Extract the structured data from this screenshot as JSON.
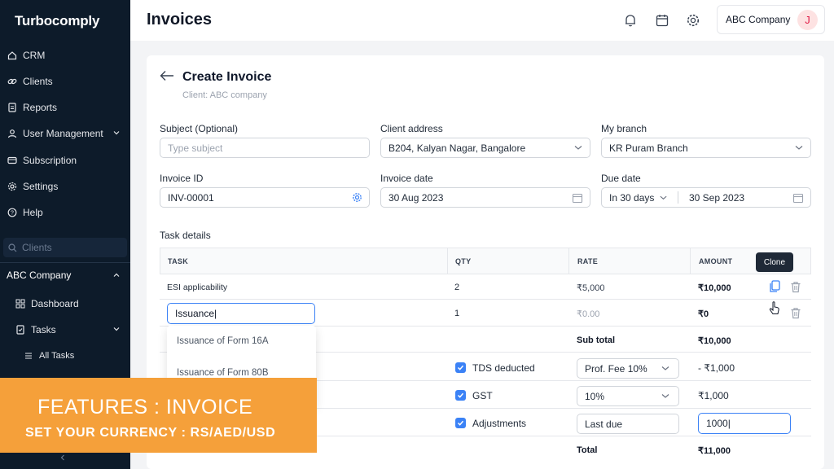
{
  "app": {
    "brand": "Turbocomply",
    "page_title": "Invoices"
  },
  "sidebar": {
    "items": [
      {
        "label": "CRM",
        "icon": "home-icon"
      },
      {
        "label": "Clients",
        "icon": "link-icon"
      },
      {
        "label": "Reports",
        "icon": "report-icon"
      },
      {
        "label": "User Management",
        "icon": "user-icon"
      },
      {
        "label": "Subscription",
        "icon": "subscription-icon"
      },
      {
        "label": "Settings",
        "icon": "gear-icon"
      },
      {
        "label": "Help",
        "icon": "help-icon"
      }
    ],
    "search_placeholder": "Clients",
    "company": "ABC Company",
    "sub_items": [
      {
        "label": "Dashboard",
        "icon": "dashboard-icon"
      },
      {
        "label": "Tasks",
        "icon": "tasks-icon"
      },
      {
        "label": "All Tasks",
        "icon": "list-icon"
      }
    ]
  },
  "header": {
    "company": "ABC Company",
    "avatar_initial": "J"
  },
  "form": {
    "title": "Create Invoice",
    "client_line": "Client: ABC company",
    "subject_label": "Subject (Optional)",
    "subject_placeholder": "Type subject",
    "client_address_label": "Client address",
    "client_address_value": "B204, Kalyan Nagar, Bangalore",
    "branch_label": "My branch",
    "branch_value": "KR Puram Branch",
    "invoice_id_label": "Invoice ID",
    "invoice_id_value": "INV-00001",
    "invoice_date_label": "Invoice date",
    "invoice_date_value": "30 Aug 2023",
    "due_date_label": "Due date",
    "due_in_value": "In 30 days",
    "due_date_value": "30 Sep 2023"
  },
  "tasks": {
    "section_label": "Task details",
    "columns": [
      "TASK",
      "QTY",
      "RATE",
      "AMOUNT"
    ],
    "rows": [
      {
        "task": "ESI applicability",
        "qty": "2",
        "rate": "₹5,000",
        "amount": "₹10,000"
      },
      {
        "task": "Issuance|",
        "qty": "1",
        "rate": "₹0.00",
        "amount": "₹0"
      }
    ],
    "suggestions": [
      "Issuance of Form 16A",
      "Issuance of Form 80B"
    ],
    "subtotal_label": "Sub total",
    "subtotal_value": "₹10,000",
    "adjust_rows": [
      {
        "label": "TDS deducted",
        "select": "Prof. Fee 10%",
        "amount": "- ₹1,000"
      },
      {
        "label": "GST",
        "select": "10%",
        "amount": "₹1,000"
      },
      {
        "label": "Adjustments",
        "select": "Last due",
        "amount": "1000|"
      }
    ],
    "total_label": "Total",
    "total_value": "₹11,000",
    "tooltip": "Clone"
  },
  "banner": {
    "title": "FEATURES : INVOICE",
    "subtitle": "SET YOUR CURRENCY : RS/AED/USD"
  },
  "colors": {
    "sidebar_bg": "#0d1b2a",
    "accent": "#3b82f6",
    "banner": "#f5a03a"
  }
}
